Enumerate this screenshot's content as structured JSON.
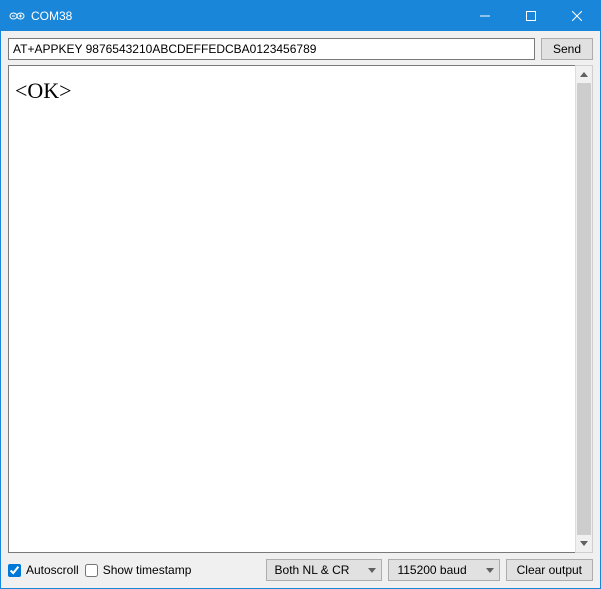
{
  "window": {
    "title": "COM38"
  },
  "input": {
    "command_value": "AT+APPKEY 9876543210ABCDEFFEDCBA0123456789",
    "send_label": "Send"
  },
  "console": {
    "output_preline": " ",
    "output_line": "<OK>"
  },
  "footer": {
    "autoscroll_label": "Autoscroll",
    "autoscroll_checked": true,
    "timestamp_label": "Show timestamp",
    "timestamp_checked": false,
    "line_ending_selected": "Both NL & CR",
    "baud_selected": "115200 baud",
    "clear_label": "Clear output"
  }
}
